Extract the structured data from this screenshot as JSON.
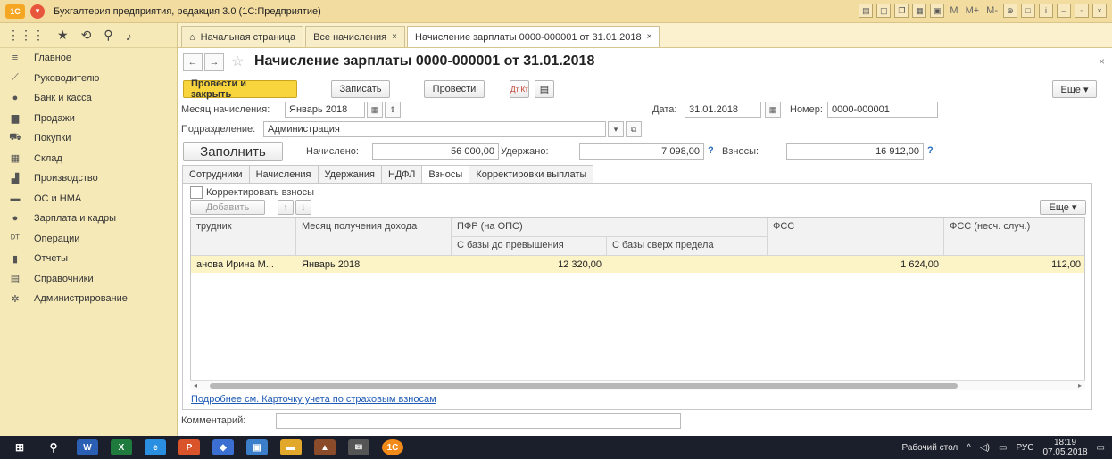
{
  "window": {
    "title": "Бухгалтерия предприятия, редакция 3.0 (1С:Предприятие)",
    "toolbar_right": [
      "M",
      "M+",
      "M-"
    ]
  },
  "sidebar": {
    "items": [
      {
        "label": "Главное",
        "icon": "menu-icon"
      },
      {
        "label": "Руководителю",
        "icon": "trend-icon"
      },
      {
        "label": "Банк и касса",
        "icon": "coin-icon"
      },
      {
        "label": "Продажи",
        "icon": "shop-icon"
      },
      {
        "label": "Покупки",
        "icon": "cart-icon"
      },
      {
        "label": "Склад",
        "icon": "warehouse-icon"
      },
      {
        "label": "Производство",
        "icon": "factory-icon"
      },
      {
        "label": "ОС и НМА",
        "icon": "truck-icon"
      },
      {
        "label": "Зарплата и кадры",
        "icon": "person-icon"
      },
      {
        "label": "Операции",
        "icon": "dtkt-icon"
      },
      {
        "label": "Отчеты",
        "icon": "chart-icon"
      },
      {
        "label": "Справочники",
        "icon": "book-icon"
      },
      {
        "label": "Администрирование",
        "icon": "gear-icon"
      }
    ]
  },
  "tabs": [
    {
      "label": "Начальная страница"
    },
    {
      "label": "Все начисления",
      "closable": "×"
    },
    {
      "label": "Начисление зарплаты 0000-000001 от 31.01.2018",
      "closable": "×",
      "active": true
    }
  ],
  "doc": {
    "title": "Начисление зарплаты 0000-000001 от 31.01.2018",
    "close": "×",
    "buttons": {
      "post_close": "Провести и закрыть",
      "save": "Записать",
      "post": "Провести",
      "dtkt": "Дт Кт",
      "more": "Еще ▾"
    },
    "month_label": "Месяц начисления:",
    "month_value": "Январь 2018",
    "date_label": "Дата:",
    "date_value": "31.01.2018",
    "number_label": "Номер:",
    "number_value": "0000-000001",
    "dept_label": "Подразделение:",
    "dept_value": "Администрация",
    "fill_button": "Заполнить",
    "accrued_label": "Начислено:",
    "accrued_value": "56 000,00",
    "withheld_label": "Удержано:",
    "withheld_value": "7 098,00",
    "contrib_label": "Взносы:",
    "contrib_value": "16 912,00",
    "help": "?"
  },
  "inner_tabs": [
    {
      "label": "Сотрудники"
    },
    {
      "label": "Начисления"
    },
    {
      "label": "Удержания"
    },
    {
      "label": "НДФЛ"
    },
    {
      "label": "Взносы",
      "active": true
    },
    {
      "label": "Корректировки выплаты"
    }
  ],
  "contrib_tab": {
    "adjust_checkbox": "Корректировать взносы",
    "adjust_checked": false,
    "add_button": "Добавить",
    "more": "Еще ▾",
    "columns": {
      "employee": "трудник",
      "month": "Месяц получения дохода",
      "pfr": "ПФР (на ОПС)",
      "pfr_base": "С базы до превышения",
      "pfr_over": "С базы сверх предела",
      "fss": "ФСС",
      "fss_acc": "ФСС (несч. случ.)"
    },
    "rows": [
      {
        "employee": "анова Ирина М...",
        "month": "Январь 2018",
        "pfr_base": "12 320,00",
        "pfr_over": "",
        "fss": "1 624,00",
        "fss_acc": "112,00"
      }
    ],
    "link": "Подробнее см. Карточку учета по страховым взносам"
  },
  "comment_label": "Комментарий:",
  "comment_value": "",
  "taskbar": {
    "desktop": "Рабочий стол",
    "lang": "РУС",
    "time": "18:19",
    "date": "07.05.2018"
  }
}
